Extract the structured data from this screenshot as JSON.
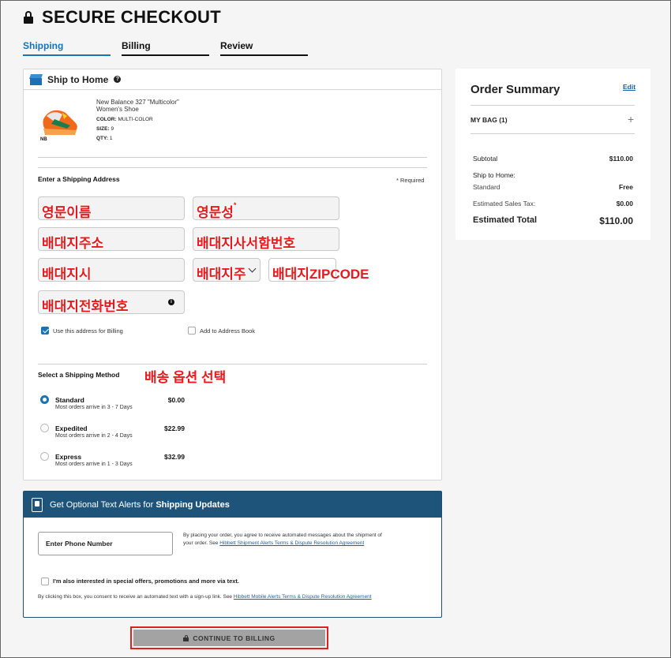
{
  "header": {
    "title": "SECURE CHECKOUT",
    "steps": [
      {
        "label": "Shipping",
        "active": true
      },
      {
        "label": "Billing",
        "active": false
      },
      {
        "label": "Review",
        "active": false
      }
    ]
  },
  "ship_card": {
    "title": "Ship to Home",
    "product": {
      "name": "New Balance 327 \"Multicolor\"",
      "type": "Women's Shoe",
      "color_label": "COLOR:",
      "color_value": "MULTI-COLOR",
      "size_label": "SIZE:",
      "size_value": "9",
      "qty_label": "QTY:",
      "qty_value": "1"
    },
    "address_label": "Enter a Shipping Address",
    "required_note": "* Required",
    "fields": {
      "first_name": "영문이름",
      "last_name": "영문성",
      "last_name_star": "*",
      "address1": "배대지주소",
      "address2": "배대지사서함번호",
      "city": "배대지시",
      "state": "배대지주",
      "zip": "배대지ZIPCODE",
      "phone": "배대지전화번호"
    },
    "use_for_billing": {
      "label": "Use this address for Billing",
      "checked": true
    },
    "add_to_book": {
      "label": "Add to Address Book",
      "checked": false
    },
    "method_label": "Select a Shipping Method",
    "method_note": "배송 옵션 선택",
    "options": [
      {
        "name": "Standard",
        "sub": "Most orders arrive in 3 - 7 Days",
        "price": "$0.00",
        "selected": true
      },
      {
        "name": "Expedited",
        "sub": "Most orders arrive in 2 - 4 Days",
        "price": "$22.99",
        "selected": false
      },
      {
        "name": "Express",
        "sub": "Most orders arrive in 1 - 3 Days",
        "price": "$32.99",
        "selected": false
      }
    ]
  },
  "alerts": {
    "title_prefix": "Get Optional Text Alerts for ",
    "title_bold": "Shipping Updates",
    "phone_placeholder": "Enter Phone Number",
    "consent_text": "By placing your order, you agree to receive automated messages about the shipment of your order. See ",
    "consent_link": "Hibbett Shipment Alerts Terms & Dispute Resolution Agreement",
    "offers_label": "I'm also interested in special offers, promotions and more via text.",
    "small_consent_text": "By clicking this box, you consent to receive an automated text with a sign-up link. See ",
    "small_consent_link": "Hibbett Mobile Alerts Terms & Dispute Resolution Agreement"
  },
  "continue_button": "CONTINUE TO BILLING",
  "summary": {
    "title": "Order Summary",
    "edit": "Edit",
    "bag": "MY BAG (1)",
    "subtotal_label": "Subtotal",
    "subtotal_value": "$110.00",
    "ship_label": "Ship to Home:",
    "standard_label": "Standard",
    "standard_value": "Free",
    "tax_label": "Estimated Sales Tax:",
    "tax_value": "$0.00",
    "total_label": "Estimated Total",
    "total_value": "$110.00"
  },
  "colors": {
    "accent": "#1a73b5",
    "alerts_header": "#1e5479",
    "annotation_red": "#e8181c",
    "button_gray": "#a3a3a3"
  }
}
